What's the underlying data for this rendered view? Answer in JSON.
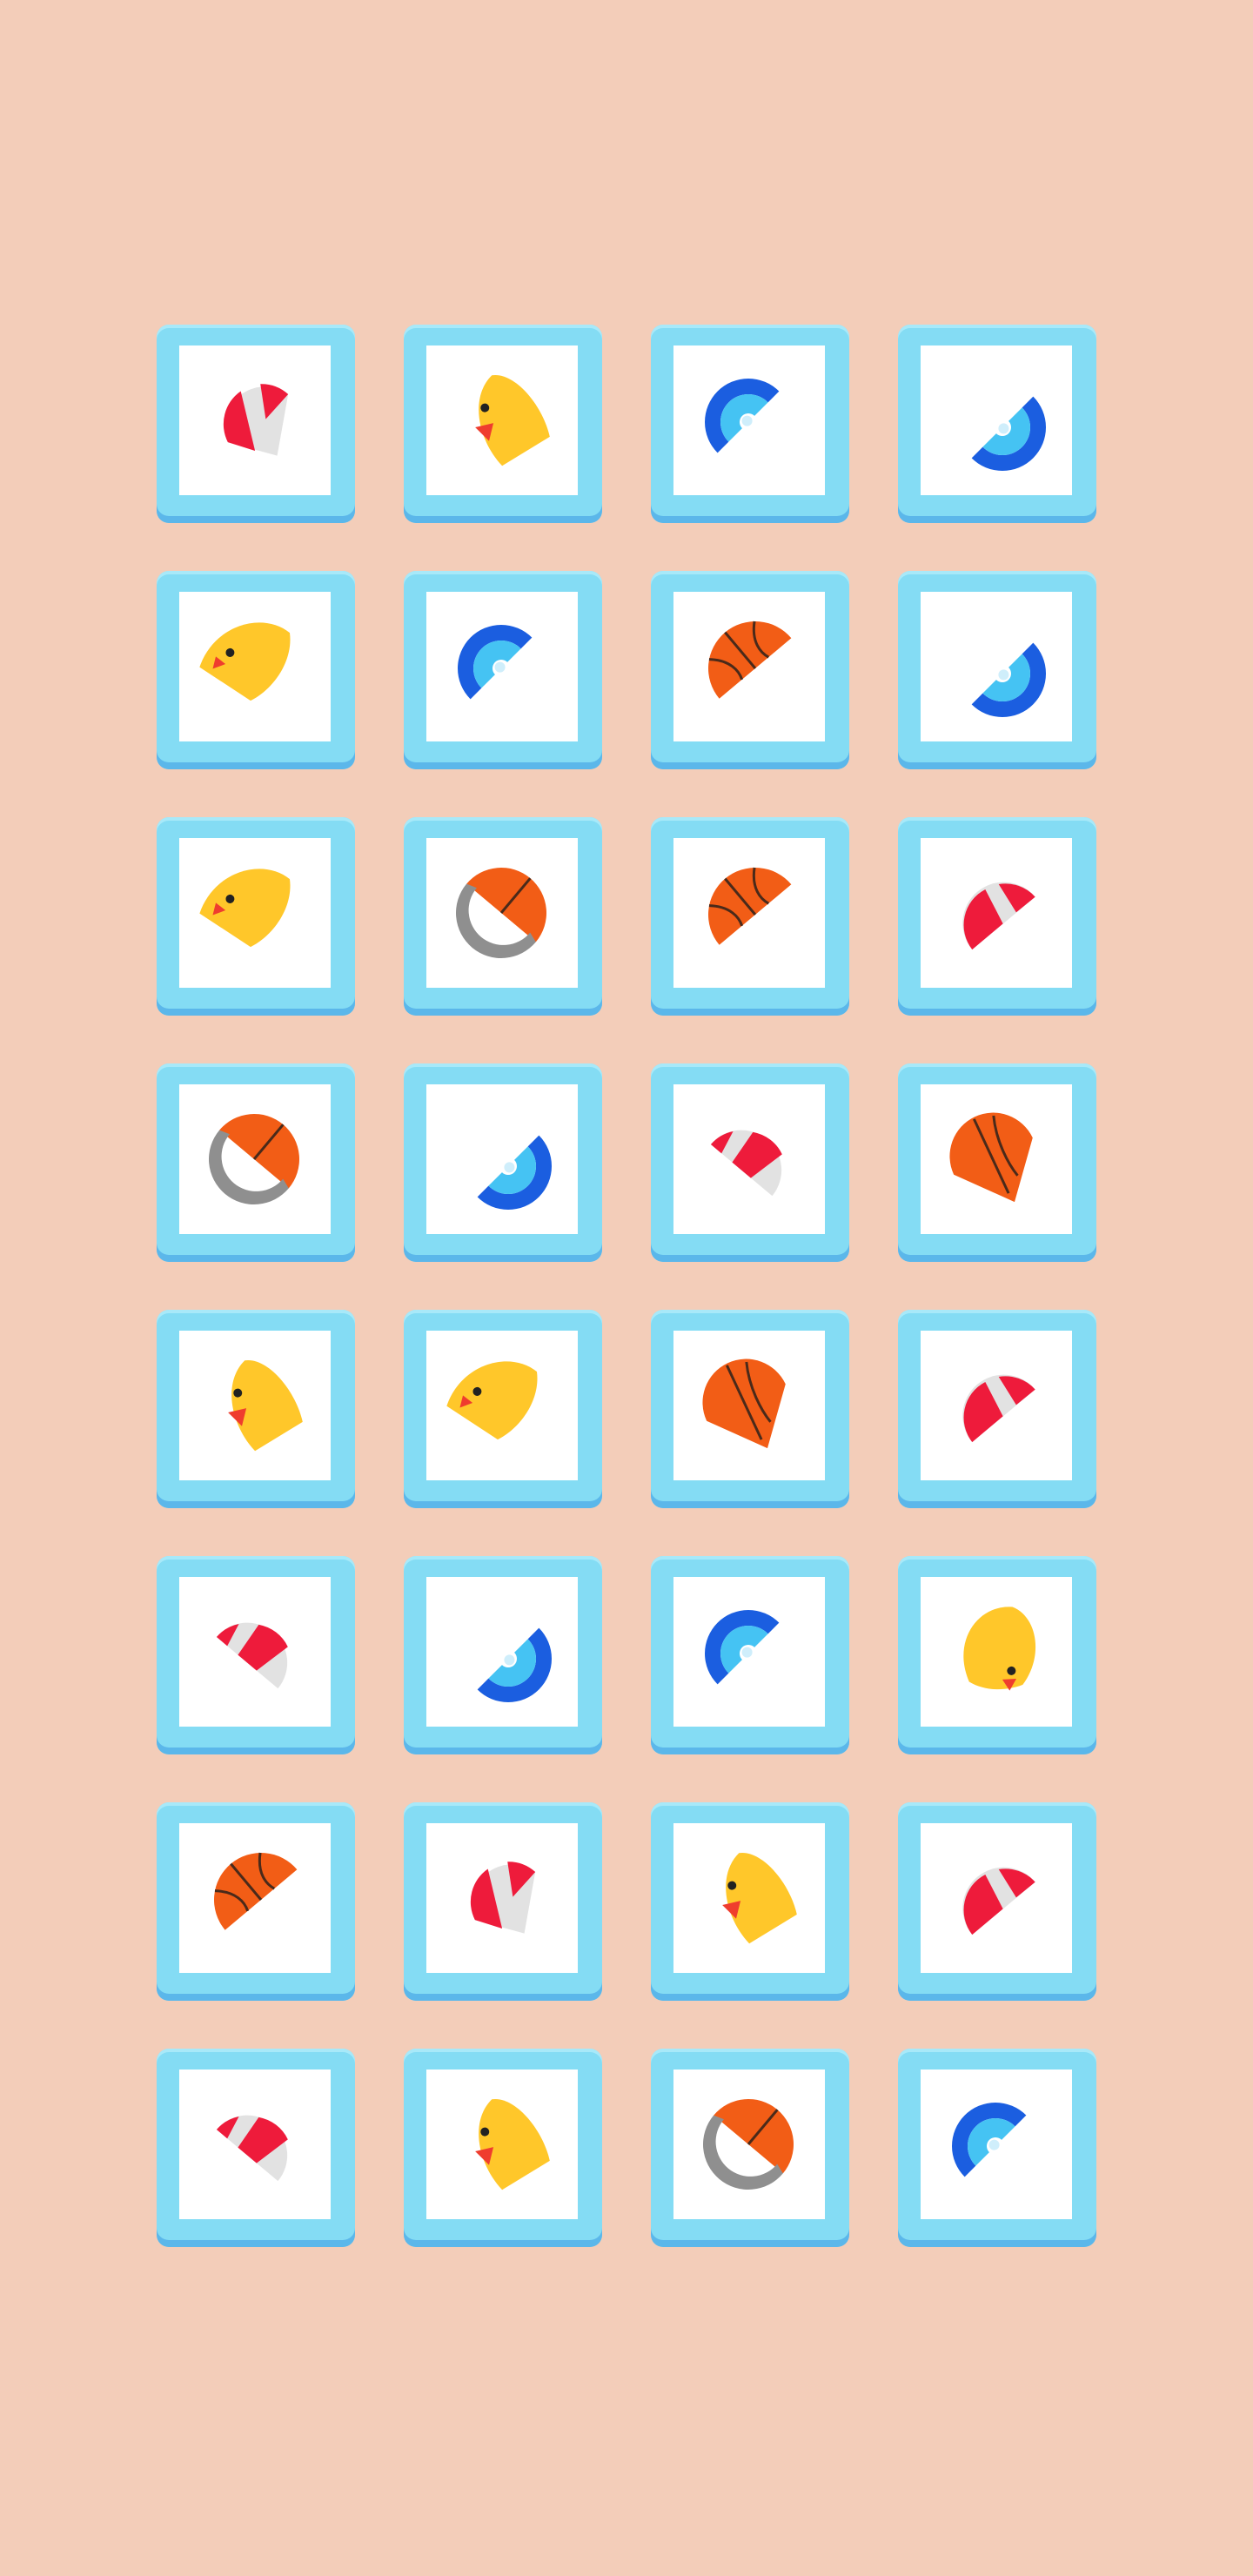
{
  "game": {
    "board": {
      "rows": 8,
      "columns": 4,
      "tiles": [
        {
          "item": "beach-ball-half",
          "variant": "a"
        },
        {
          "item": "rubber-duck-half",
          "variant": "a"
        },
        {
          "item": "frisbee-half",
          "variant": "a"
        },
        {
          "item": "frisbee-half",
          "variant": "b"
        },
        {
          "item": "rubber-duck-half",
          "variant": "b"
        },
        {
          "item": "frisbee-half",
          "variant": "a"
        },
        {
          "item": "basketball-half",
          "variant": "a"
        },
        {
          "item": "frisbee-half",
          "variant": "b"
        },
        {
          "item": "rubber-duck-half",
          "variant": "b"
        },
        {
          "item": "basketball-half",
          "variant": "b"
        },
        {
          "item": "basketball-half",
          "variant": "a"
        },
        {
          "item": "beach-ball-half",
          "variant": "b"
        },
        {
          "item": "basketball-half",
          "variant": "b"
        },
        {
          "item": "frisbee-half",
          "variant": "b"
        },
        {
          "item": "beach-ball-half",
          "variant": "c"
        },
        {
          "item": "basketball-half",
          "variant": "c"
        },
        {
          "item": "rubber-duck-half",
          "variant": "a"
        },
        {
          "item": "rubber-duck-half",
          "variant": "b"
        },
        {
          "item": "basketball-half",
          "variant": "c"
        },
        {
          "item": "beach-ball-half",
          "variant": "b"
        },
        {
          "item": "beach-ball-half",
          "variant": "c"
        },
        {
          "item": "frisbee-half",
          "variant": "b"
        },
        {
          "item": "frisbee-half",
          "variant": "a"
        },
        {
          "item": "rubber-duck-half",
          "variant": "c"
        },
        {
          "item": "basketball-half",
          "variant": "a"
        },
        {
          "item": "beach-ball-half",
          "variant": "a"
        },
        {
          "item": "rubber-duck-half",
          "variant": "a"
        },
        {
          "item": "beach-ball-half",
          "variant": "b"
        },
        {
          "item": "beach-ball-half",
          "variant": "c"
        },
        {
          "item": "rubber-duck-half",
          "variant": "a"
        },
        {
          "item": "basketball-half",
          "variant": "b"
        },
        {
          "item": "frisbee-half",
          "variant": "a"
        }
      ]
    },
    "colors": {
      "background": "#f3cdb9",
      "tile_frame": "#84dcf4",
      "tile_face": "#ffffff",
      "duck": "#ffc72a",
      "duck_beak": "#ef3d2e",
      "basketball": "#f25d16",
      "frisbee_outer": "#1b5ee0",
      "frisbee_inner": "#45c3f3",
      "beach_ball_red": "#ee1b3b",
      "beach_ball_white": "#e2e2e2"
    }
  }
}
